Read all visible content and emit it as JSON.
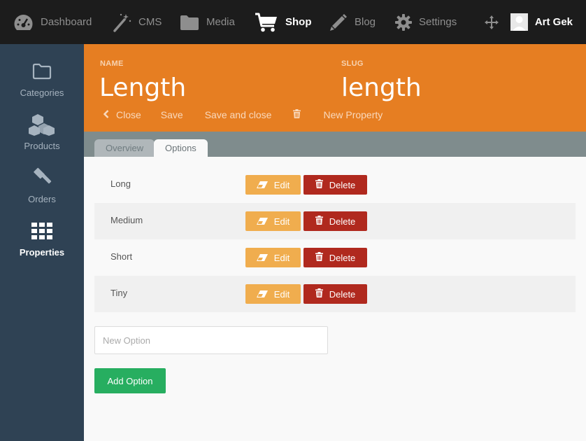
{
  "topnav": {
    "items": [
      {
        "label": "Dashboard",
        "icon": "dashboard-gauge-icon"
      },
      {
        "label": "CMS",
        "icon": "magic-wand-icon"
      },
      {
        "label": "Media",
        "icon": "folder-icon"
      },
      {
        "label": "Shop",
        "icon": "shopping-cart-icon"
      },
      {
        "label": "Blog",
        "icon": "pencil-icon"
      },
      {
        "label": "Settings",
        "icon": "gear-icon"
      }
    ],
    "active": "Shop",
    "user": "Art Gek"
  },
  "sidebar": {
    "items": [
      {
        "label": "Categories",
        "icon": "folder-outline-icon"
      },
      {
        "label": "Products",
        "icon": "cubes-icon"
      },
      {
        "label": "Orders",
        "icon": "gavel-icon"
      },
      {
        "label": "Properties",
        "icon": "grid-icon"
      }
    ],
    "active": "Properties"
  },
  "header": {
    "name_label": "NAME",
    "name_value": "Length",
    "slug_label": "SLUG",
    "slug_value": "length",
    "actions": {
      "close": "Close",
      "save": "Save",
      "save_and_close": "Save and close",
      "new_property": "New Property"
    }
  },
  "tabs": [
    {
      "label": "Overview",
      "active": false
    },
    {
      "label": "Options",
      "active": true
    }
  ],
  "options": [
    {
      "name": "Long"
    },
    {
      "name": "Medium"
    },
    {
      "name": "Short"
    },
    {
      "name": "Tiny"
    }
  ],
  "row_buttons": {
    "edit": "Edit",
    "delete": "Delete"
  },
  "new_option": {
    "placeholder": "New Option",
    "value": ""
  },
  "add_option_label": "Add Option",
  "colors": {
    "topnav_bg": "#1c1c1c",
    "sidebar_bg": "#2f4254",
    "header_bg": "#e67e22",
    "tabbar_bg": "#7f8c8d",
    "edit_btn": "#f0ad4e",
    "delete_btn": "#b0291e",
    "add_btn": "#27ae60"
  }
}
